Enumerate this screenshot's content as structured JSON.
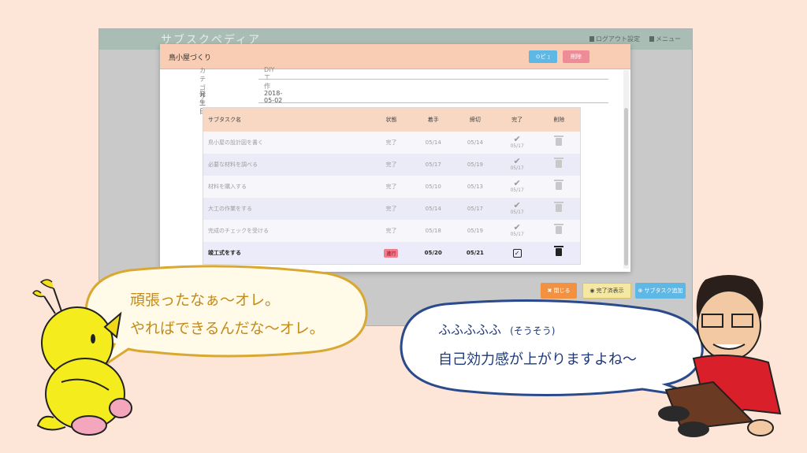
{
  "app": {
    "title": "サブスクペディア",
    "menu": [
      "ログアウト設定",
      "メニュー"
    ]
  },
  "modal": {
    "title": "鳥小屋づくり",
    "edit_label": "⊙ピ ｪ",
    "delete_label": "削除",
    "fields": [
      {
        "label": "カテゴリ",
        "value": "DIY工作"
      },
      {
        "label": "発生日",
        "value": "2018-05-02"
      }
    ]
  },
  "table": {
    "headers": [
      "サブタスク名",
      "状態",
      "着手",
      "締切",
      "完了",
      "削除"
    ],
    "rows": [
      {
        "name": "鳥小屋の設計図を書く",
        "status": "完了",
        "start": "05/14",
        "due": "05/14",
        "done": "05/17"
      },
      {
        "name": "必要な材料を調べる",
        "status": "完了",
        "start": "05/17",
        "due": "05/19",
        "done": "05/17"
      },
      {
        "name": "材料を購入する",
        "status": "完了",
        "start": "05/10",
        "due": "05/13",
        "done": "05/17"
      },
      {
        "name": "大工の作業をする",
        "status": "完了",
        "start": "05/14",
        "due": "05/17",
        "done": "05/17"
      },
      {
        "name": "完成のチェックを受ける",
        "status": "完了",
        "start": "05/18",
        "due": "05/19",
        "done": "05/17"
      },
      {
        "name": "竣工式をする",
        "status": "進行",
        "start": "05/20",
        "due": "05/21",
        "done": ""
      }
    ]
  },
  "buttons": {
    "close": "✖ 閉じる",
    "show_done": "◉ 完了済表示",
    "add_subtask": "⊕ サブタスク追加"
  },
  "speech": {
    "bird_line1": "頑張ったなぁ～オレ。",
    "bird_line2": "やればできるんだな～オレ。",
    "man_line1": "ふふふふふ",
    "man_line1_note": "(そうそう)",
    "man_line2": "自己効力感が上がりますよね～"
  }
}
